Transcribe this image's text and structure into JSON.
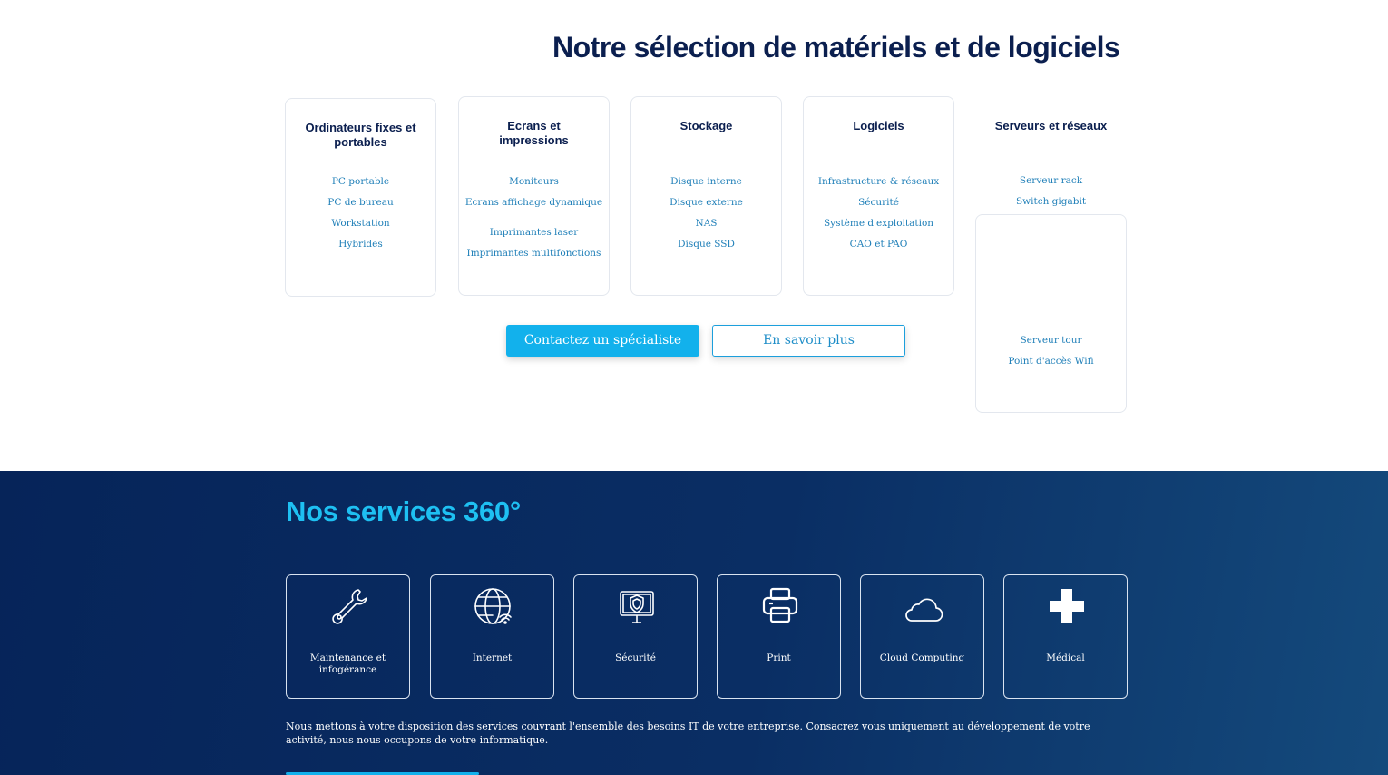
{
  "selection": {
    "title": "Notre sélection de matériels et de logiciels",
    "categories": [
      {
        "title": "Ordinateurs fixes et portables",
        "links": [
          "PC portable",
          "PC de bureau",
          "Workstation",
          "Hybrides"
        ]
      },
      {
        "title": "Ecrans et impressions",
        "links": [
          "Moniteurs",
          "Ecrans affichage dynamique",
          "Imprimantes laser",
          "Imprimantes multifonctions"
        ]
      },
      {
        "title": "Stockage",
        "links": [
          "Disque interne",
          "Disque externe",
          "NAS",
          "Disque SSD"
        ]
      },
      {
        "title": "Logiciels",
        "links": [
          "Infrastructure & réseaux",
          "Sécurité",
          "Système d'exploitation",
          "CAO et PAO"
        ]
      },
      {
        "title": "Serveurs et réseaux",
        "links": [
          "Serveur rack",
          "Switch gigabit",
          "Serveur tour",
          "Point d'accès Wifi"
        ]
      }
    ],
    "buttons": {
      "contact": "Contactez un spécialiste",
      "more": "En savoir plus"
    }
  },
  "services": {
    "title": "Nos services 360°",
    "items": [
      {
        "label": "Maintenance et infogérance",
        "icon": "wrench-icon"
      },
      {
        "label": "Internet",
        "icon": "globe-wifi-icon"
      },
      {
        "label": "Sécurité",
        "icon": "security-monitor-icon"
      },
      {
        "label": "Print",
        "icon": "printer-icon"
      },
      {
        "label": "Cloud Computing",
        "icon": "cloud-icon"
      },
      {
        "label": "Médical",
        "icon": "medical-cross-icon"
      }
    ],
    "description": "Nous mettons à votre disposition des services couvrant l'ensemble des besoins IT de votre entreprise. Consacrez vous uniquement au développement de votre activité, nous nous occupons de votre informatique.",
    "colors": {
      "background": "#062459",
      "accent": "#1ec0f2"
    }
  }
}
